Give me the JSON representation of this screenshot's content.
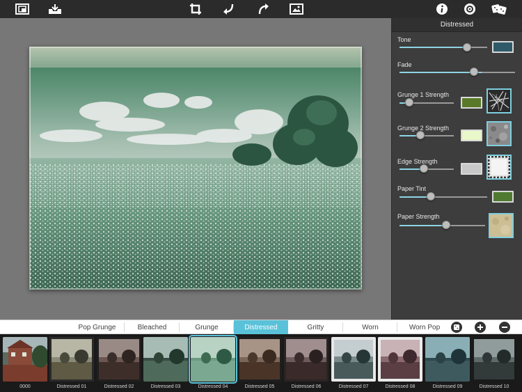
{
  "toolbar": {
    "left_icons": [
      "frame-icon",
      "save-tray-icon"
    ],
    "center_icons": [
      "crop-icon",
      "undo-icon",
      "redo-icon",
      "compare-icon"
    ],
    "right_icons": [
      "info-icon",
      "settings-icon",
      "random-dice-icon"
    ]
  },
  "panel": {
    "title": "Distressed",
    "controls": [
      {
        "label": "Tone",
        "value": 0.81,
        "swatch": "#2f5a6a"
      },
      {
        "label": "Fade",
        "value": 0.72
      },
      {
        "label": "Grunge 1 Strength",
        "value": 0.18,
        "swatch": "#5a7a2a",
        "texture": "grunge-1-texture"
      },
      {
        "label": "Grunge 2 Strength",
        "value": 0.39,
        "swatch": "#e8f8c8",
        "texture": "grunge-2-texture"
      },
      {
        "label": "Edge Strength",
        "value": 0.45,
        "swatch": "#c8c8c8",
        "texture": "edge-texture"
      },
      {
        "label": "Paper Tint",
        "value": 0.37,
        "swatch": "#4f7a30"
      },
      {
        "label": "Paper Strength",
        "value": 0.53,
        "texture": "paper-texture"
      }
    ]
  },
  "tabs": {
    "items": [
      "Pop Grunge",
      "Bleached",
      "Grunge",
      "Distressed",
      "Gritty",
      "Worn",
      "Worn Pop"
    ],
    "active": "Distressed",
    "buttons": [
      "dice-icon",
      "add-icon",
      "remove-icon"
    ]
  },
  "thumbnails": {
    "items": [
      "0000",
      "Distressed 01",
      "Distressed 02",
      "Distressed 03",
      "Distressed 04",
      "Distressed 05",
      "Distressed 06",
      "Distressed 07",
      "Distressed 08",
      "Distressed 09",
      "Distressed 10"
    ],
    "selected": "Distressed 04"
  },
  "colors": {
    "accent": "#59c2d9",
    "toolbar_bg": "#2b2b2b",
    "panel_bg": "#3d3d3d",
    "canvas_bg": "#777777"
  }
}
